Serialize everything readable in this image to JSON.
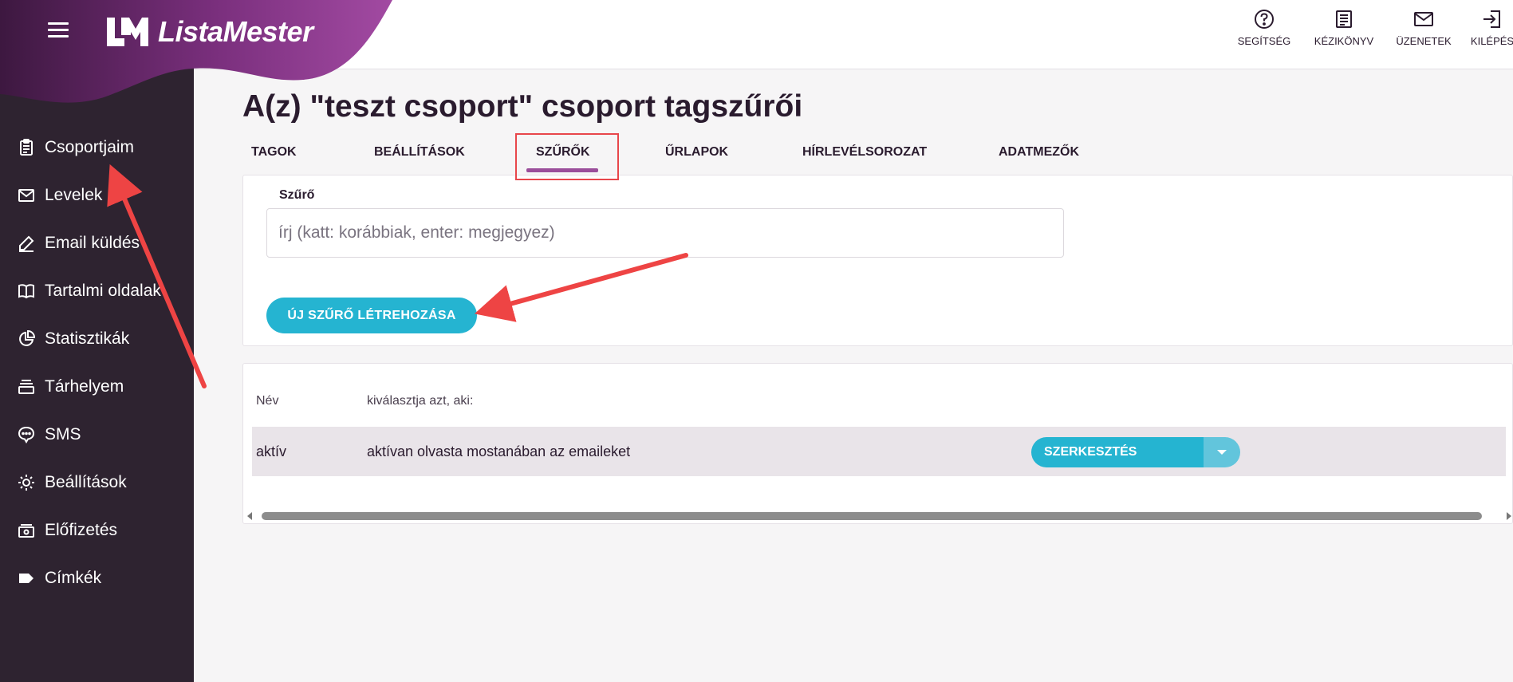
{
  "brand": {
    "name": "ListaMester",
    "logo_icon": "lm-logo-icon",
    "primary_color": "#9b4e9b",
    "accent_color": "#25b4d1",
    "sidebar_bg": "#2e2330"
  },
  "sidebar": {
    "items": [
      {
        "label": "Csoportjaim",
        "icon": "clipboard-icon"
      },
      {
        "label": "Levelek",
        "icon": "mail-icon"
      },
      {
        "label": "Email küldés",
        "icon": "pen-icon"
      },
      {
        "label": "Tartalmi oldalak",
        "icon": "book-icon"
      },
      {
        "label": "Statisztikák",
        "icon": "pie-chart-icon"
      },
      {
        "label": "Tárhelyem",
        "icon": "storage-icon"
      },
      {
        "label": "SMS",
        "icon": "chat-icon"
      },
      {
        "label": "Beállítások",
        "icon": "gear-icon"
      },
      {
        "label": "Előfizetés",
        "icon": "money-icon"
      },
      {
        "label": "Címkék",
        "icon": "tag-icon"
      }
    ]
  },
  "topbar": {
    "actions": [
      {
        "label": "SEGÍTSÉG",
        "icon": "help-icon"
      },
      {
        "label": "KÉZIKÖNYV",
        "icon": "manual-icon"
      },
      {
        "label": "ÜZENETEK",
        "icon": "messages-icon"
      },
      {
        "label": "KILÉPÉS",
        "icon": "logout-icon"
      }
    ]
  },
  "page": {
    "title": "A(z) \"teszt csoport\" csoport tagszűrői"
  },
  "tabs": [
    {
      "label": "TAGOK",
      "active": false
    },
    {
      "label": "BEÁLLÍTÁSOK",
      "active": false
    },
    {
      "label": "SZŰRŐK",
      "active": true
    },
    {
      "label": "ŰRLAPOK",
      "active": false
    },
    {
      "label": "HÍRLEVÉLSOROZAT",
      "active": false
    },
    {
      "label": "ADATMEZŐK",
      "active": false
    }
  ],
  "filter": {
    "label": "Szűrő",
    "input_value": "",
    "placeholder": "írj (katt: korábbiak, enter: megjegyez)",
    "new_button_label": "ÚJ SZŰRŐ LÉTREHOZÁSA"
  },
  "table": {
    "headers": [
      "Név",
      "kiválasztja azt, aki:"
    ],
    "rows": [
      {
        "name": "aktív",
        "description": "aktívan olvasta mostanában az emaileket",
        "action_label": "SZERKESZTÉS",
        "action_menu_icon": "caret-down-icon"
      }
    ]
  }
}
